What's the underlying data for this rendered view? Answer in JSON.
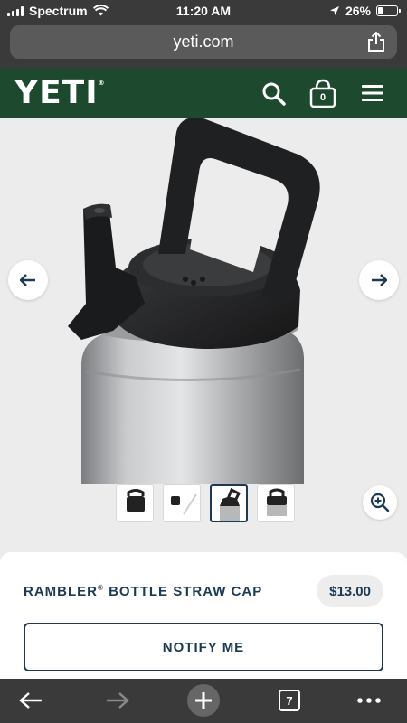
{
  "status_bar": {
    "carrier": "Spectrum",
    "time": "11:20 AM",
    "battery_percent": "26%",
    "battery_level": 0.26
  },
  "browser": {
    "url": "yeti.com",
    "tab_count": "7"
  },
  "site_header": {
    "logo": "YETI",
    "logo_mark": "®",
    "cart_count": "0",
    "icons": [
      "search-icon",
      "cart-icon",
      "menu-icon"
    ]
  },
  "gallery": {
    "thumbnails": [
      "thumb-cap-front",
      "thumb-cap-straw",
      "thumb-bottle-cap",
      "thumb-cap-back"
    ],
    "active_index": 2
  },
  "product": {
    "title": "RAMBLER",
    "title_mark": "®",
    "title_rest": " BOTTLE STRAW CAP",
    "price": "$13.00",
    "cta_label": "NOTIFY ME"
  },
  "colors": {
    "brand_green": "#1d4a2e",
    "navy": "#1c3a54",
    "browser_chrome": "#3a3a3a"
  }
}
